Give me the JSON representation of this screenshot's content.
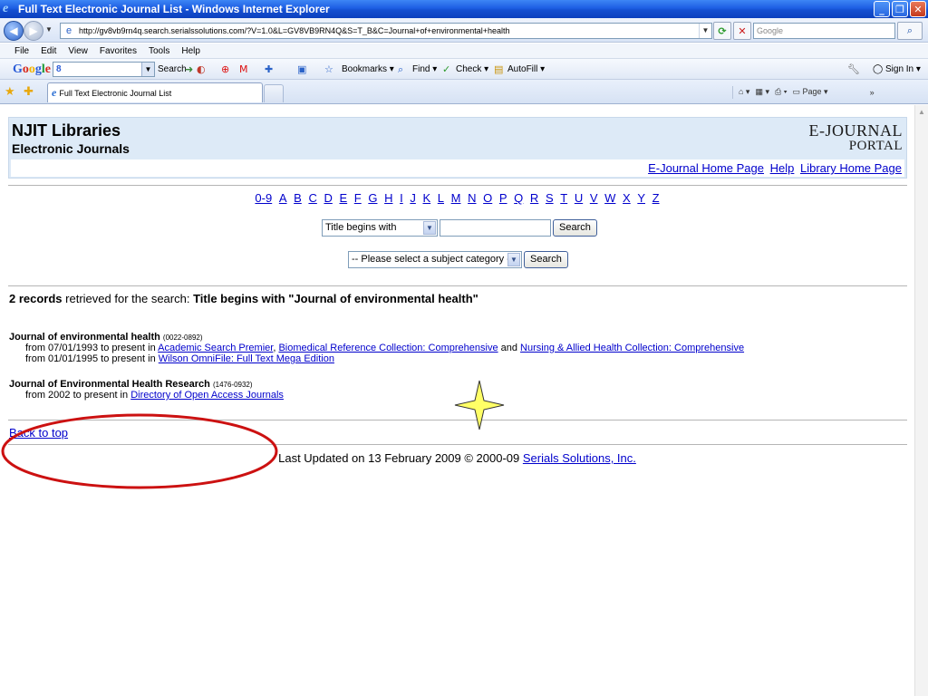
{
  "window": {
    "title": "Full Text Electronic Journal List - Windows Internet Explorer"
  },
  "address_bar": {
    "url": "http://gv8vb9rn4q.search.serialssolutions.com/?V=1.0&L=GV8VB9RN4Q&S=T_B&C=Journal+of+environmental+health",
    "search_placeholder": "Google"
  },
  "menu": {
    "items": [
      "File",
      "Edit",
      "View",
      "Favorites",
      "Tools",
      "Help"
    ]
  },
  "google_toolbar": {
    "logo_letters": [
      "G",
      "o",
      "o",
      "g",
      "l",
      "e"
    ],
    "search_value": "8",
    "search_label": "Search",
    "bookmarks_label": "Bookmarks",
    "find_label": "Find",
    "check_label": "Check",
    "autofill_label": "AutoFill",
    "signin_label": "Sign In"
  },
  "tabs": {
    "active_title": "Full Text Electronic Journal List",
    "page_label": "Page"
  },
  "header": {
    "org": "NJIT Libraries",
    "subtitle": "Electronic Journals",
    "logo_line1": "E-JOURNAL",
    "logo_line2": "PORTAL",
    "links": [
      "E-Journal Home Page",
      "Help",
      "Library Home Page"
    ]
  },
  "alpha_nav": [
    "0-9",
    "A",
    "B",
    "C",
    "D",
    "E",
    "F",
    "G",
    "H",
    "I",
    "J",
    "K",
    "L",
    "M",
    "N",
    "O",
    "P",
    "Q",
    "R",
    "S",
    "T",
    "U",
    "V",
    "W",
    "X",
    "Y",
    "Z"
  ],
  "title_search": {
    "selected": "Title begins with",
    "button": "Search"
  },
  "subject_search": {
    "selected": "-- Please select a subject category --",
    "button": "Search"
  },
  "results": {
    "count": "2 records",
    "retrieved_text": " retrieved for the search: ",
    "query": "Title begins with \"Journal of environmental health\"",
    "journals": [
      {
        "title": "Journal of environmental health",
        "issn": "(0022-0892)",
        "coverage": [
          {
            "prefix": "from 07/01/1993 to present in ",
            "links": [
              "Academic Search Premier",
              "Biomedical Reference Collection: Comprehensive",
              "Nursing & Allied Health Collection: Comprehensive"
            ],
            "seps": [
              ", ",
              " and "
            ]
          },
          {
            "prefix": "from 01/01/1995 to present in ",
            "links": [
              "Wilson OmniFile: Full Text Mega Edition"
            ],
            "seps": []
          }
        ]
      },
      {
        "title": "Journal of Environmental Health Research",
        "issn": "(1476-0932)",
        "coverage": [
          {
            "prefix": "from 2002 to present in ",
            "links": [
              "Directory of Open Access Journals"
            ],
            "seps": []
          }
        ]
      }
    ]
  },
  "back_to_top": "Back to top",
  "footer": {
    "text": "Last Updated on 13 February 2009 © 2000-09 ",
    "link": "Serials Solutions, Inc."
  },
  "colors": {
    "link": "#0000cc",
    "header_bg": "#ddeaf7",
    "annotation_ellipse": "#cc1111",
    "annotation_star": "#ffff66"
  }
}
